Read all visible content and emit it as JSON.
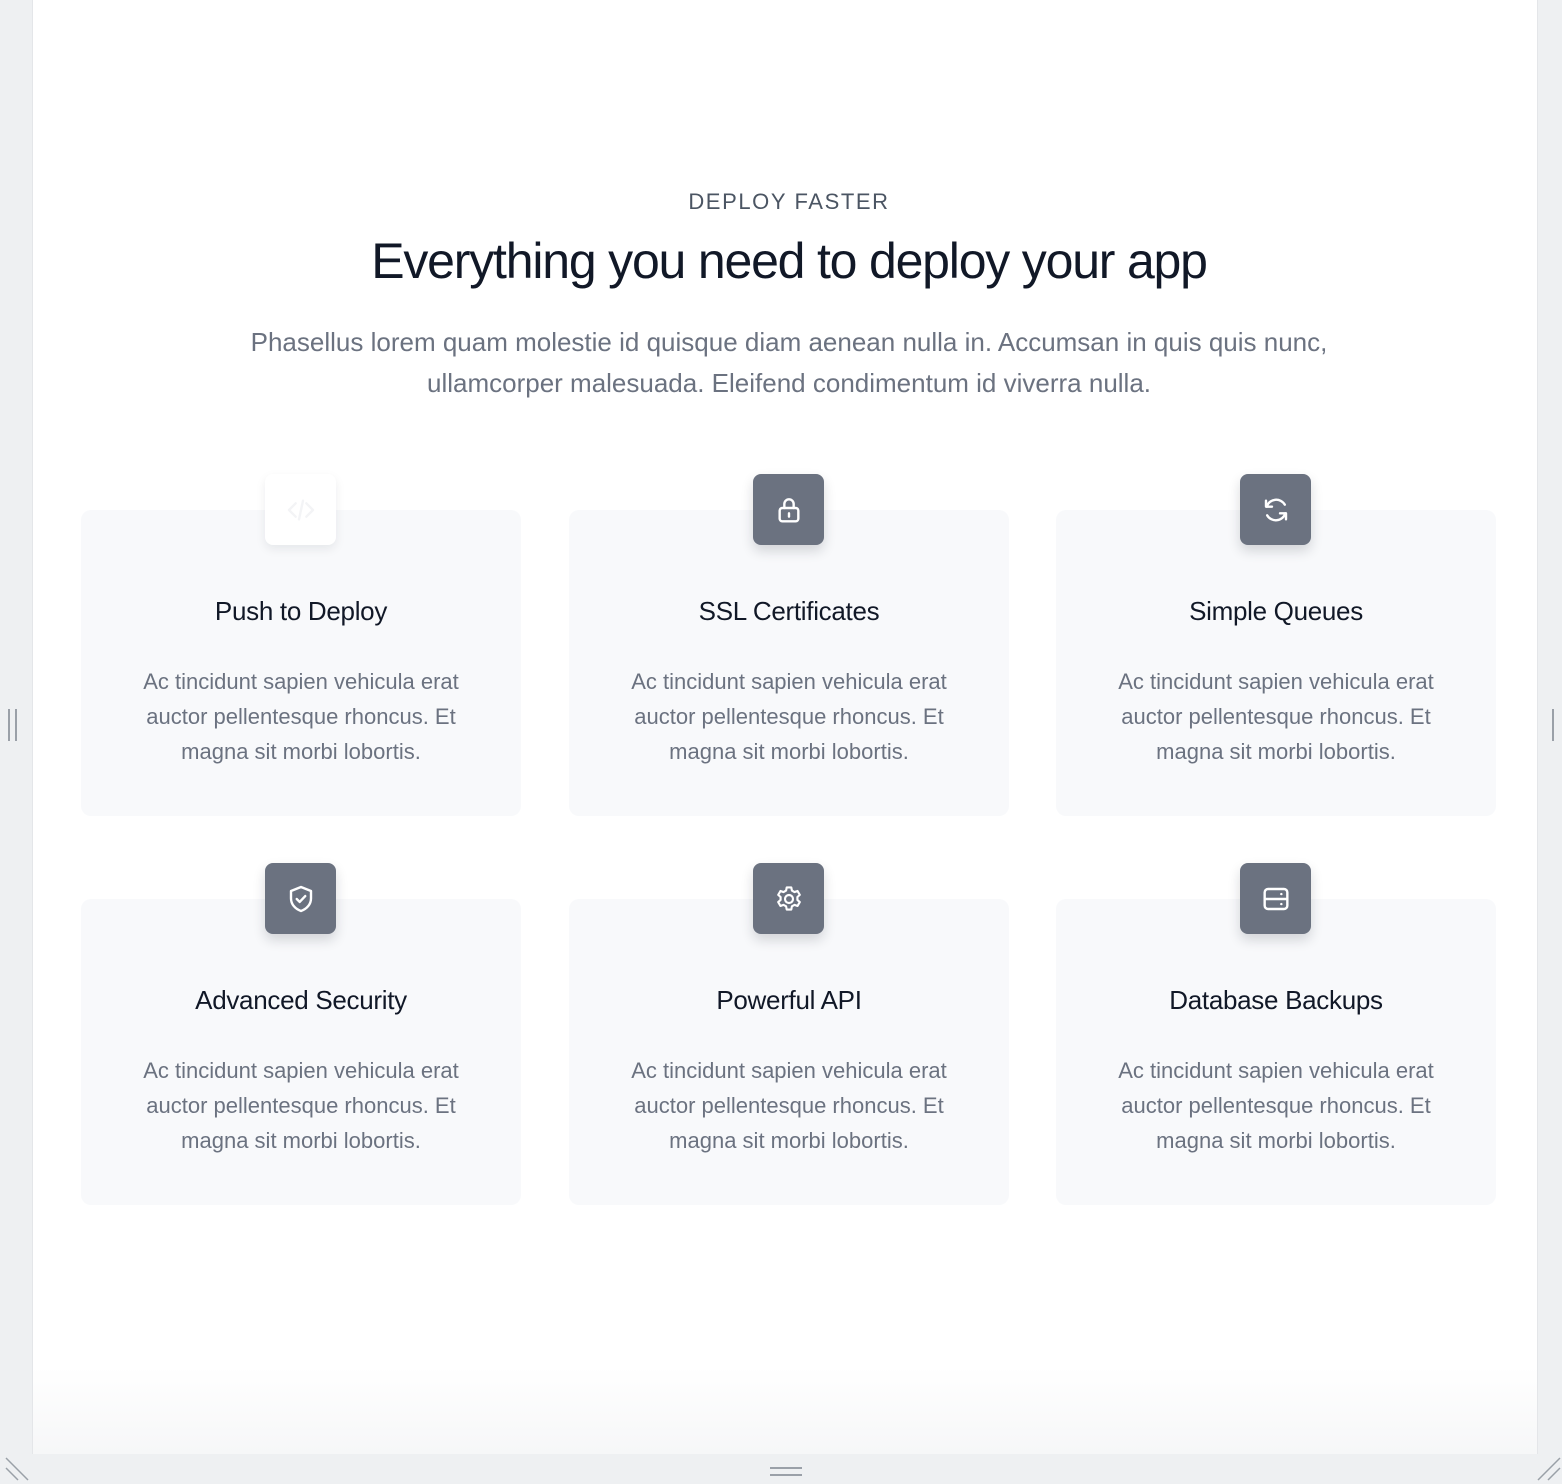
{
  "section": {
    "eyebrow": "DEPLOY FASTER",
    "headline": "Everything you need to deploy your app",
    "lead": "Phasellus lorem quam molestie id quisque diam aenean nulla in. Accumsan in quis quis nunc, ullamcorper malesuada. Eleifend condimentum id viverra nulla."
  },
  "features": [
    {
      "title": "Push to Deploy",
      "text": "Ac tincidunt sapien vehicula erat auctor pellentesque rhoncus. Et magna sit morbi lobortis.",
      "icon": "code-icon"
    },
    {
      "title": "SSL Certificates",
      "text": "Ac tincidunt sapien vehicula erat auctor pellentesque rhoncus. Et magna sit morbi lobortis.",
      "icon": "lock-icon"
    },
    {
      "title": "Simple Queues",
      "text": "Ac tincidunt sapien vehicula erat auctor pellentesque rhoncus. Et magna sit morbi lobortis.",
      "icon": "refresh-icon"
    },
    {
      "title": "Advanced Security",
      "text": "Ac tincidunt sapien vehicula erat auctor pellentesque rhoncus. Et magna sit morbi lobortis.",
      "icon": "shield-check-icon"
    },
    {
      "title": "Powerful API",
      "text": "Ac tincidunt sapien vehicula erat auctor pellentesque rhoncus. Et magna sit morbi lobortis.",
      "icon": "cog-icon"
    },
    {
      "title": "Database Backups",
      "text": "Ac tincidunt sapien vehicula erat auctor pellentesque rhoncus. Et magna sit morbi lobortis.",
      "icon": "server-icon"
    }
  ],
  "colors": {
    "icon_tile": "#6b7280",
    "card_bg": "#f8f9fb",
    "heading": "#111827",
    "body": "#6b7280"
  }
}
